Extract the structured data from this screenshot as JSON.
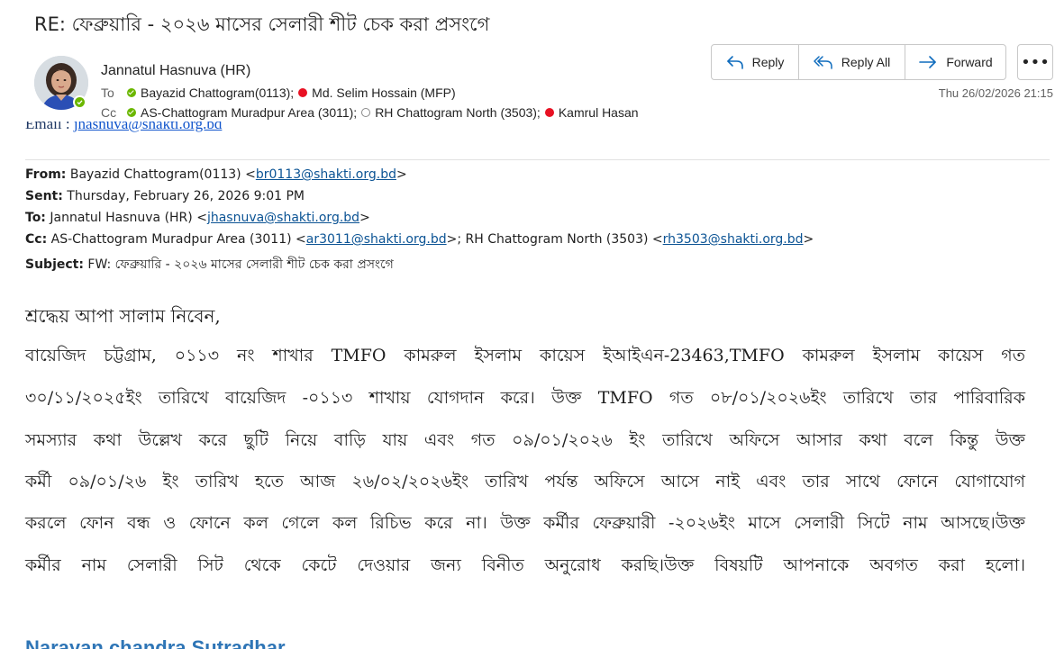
{
  "subject": "RE: ফেব্রুয়ারি - ২০২৬ মাসের সেলারী শীট চেক করা প্রসংগে",
  "sender": {
    "name": "Jannatul Hasnuva (HR)",
    "presence": "available"
  },
  "to_label": "To",
  "cc_label": "Cc",
  "to_recipients": [
    {
      "name": "Bayazid Chattogram(0113);",
      "status": "available"
    },
    {
      "name": "Md. Selim Hossain (MFP)",
      "status": "busy"
    }
  ],
  "cc_recipients": [
    {
      "name": "AS-Chattogram Muradpur Area (3011);",
      "status": "available"
    },
    {
      "name": "RH Chattogram North (3503);",
      "status": "offline"
    },
    {
      "name": "Kamrul Hasan",
      "status": "busy"
    }
  ],
  "actions": {
    "reply": "Reply",
    "reply_all": "Reply All",
    "forward": "Forward",
    "more": "•••"
  },
  "timestamp": "Thu 26/02/2026 21:15",
  "clipped_line": {
    "label": "Email  :  ",
    "email": "jhasnuva@shakti.org.bd"
  },
  "forwarded": {
    "from_label": "From:",
    "from_name": " Bayazid Chattogram(0113) <",
    "from_email": "br0113@shakti.org.bd",
    "from_close": ">",
    "sent_label": "Sent:",
    "sent_value": " Thursday, February 26, 2026 9:01 PM",
    "to_label": "To:",
    "to_name": " Jannatul Hasnuva (HR) <",
    "to_email": "jhasnuva@shakti.org.bd",
    "to_close": ">",
    "cc_label": "Cc:",
    "cc_name1": " AS-Chattogram Muradpur Area (3011) <",
    "cc_email1": "ar3011@shakti.org.bd",
    "cc_mid": ">; RH Chattogram North (3503) <",
    "cc_email2": "rh3503@shakti.org.bd",
    "cc_close": ">",
    "subject_label": "Subject:",
    "subject_value": " FW: ফেব্রুয়ারি - ২০২৬ মাসের সেলারী শীট চেক করা প্রসংগে"
  },
  "body": {
    "greeting": "শ্রদ্ধেয় আপা  সালাম  নিবেন,",
    "lines": [
      "বায়েজিদ চট্টগ্রাম, ০১১৩ নং শাখার TMFO কামরুল ইসলাম কায়েস ইআইএন-23463,TMFO কামরুল ইসলাম কায়েস গত",
      "৩০/১১/২০২৫ইং তারিখে বায়েজিদ -০১১৩ শাখায় যোগদান করে। উক্ত TMFO গত ০৮/০১/২০২৬ইং তারিখে তার পারিবারিক",
      "সমস্যার কথা উল্লেখ করে ছুটি নিয়ে বাড়ি যায় এবং গত ০৯/০১/২০২৬ ইং তারিখে অফিসে আসার কথা বলে কিন্তু উক্ত",
      "কর্মী ০৯/০১/২৬ ইং তারিখ হতে আজ ২৬/০২/২০২৬ইং তারিখ পর্যন্ত অফিসে আসে নাই এবং তার সাথে ফোনে যোগাযোগ",
      "করলে ফোন বন্ধ ও ফোনে কল গেলে কল রিচিভ করে না। উক্ত কর্মীর ফেব্রুয়ারী -২০২৬ইং মাসে সেলারী সিটে নাম আসছে।উক্ত",
      "কর্মীর নাম সেলারী সিট থেকে কেটে দেওয়ার জন্য বিনীত অনুরোধ করছি।উক্ত বিষয়টি আপনাকে অবগত করা হলো।"
    ]
  },
  "signature": "Narayan chandra Sutradhar",
  "colors": {
    "available": "#6bb700",
    "busy": "#e81123",
    "link": "#0b5394",
    "signature": "#2e75b6",
    "action_icon": "#0f6cbd"
  }
}
